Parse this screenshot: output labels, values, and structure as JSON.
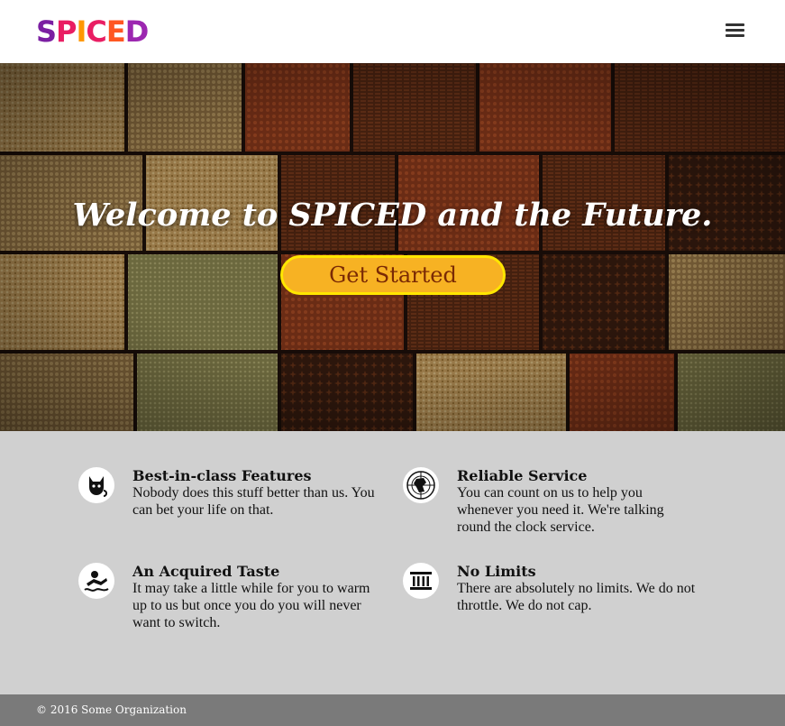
{
  "brand": {
    "letters": [
      {
        "char": "S",
        "color": "#7b1fa2"
      },
      {
        "char": "P",
        "color": "#e91e63"
      },
      {
        "char": "I",
        "color": "#ff9800"
      },
      {
        "char": "C",
        "color": "#e91e63"
      },
      {
        "char": "E",
        "color": "#ff5722"
      },
      {
        "char": "D",
        "color": "#9c27b0"
      }
    ]
  },
  "header": {
    "menu_icon": "hamburger-menu-icon"
  },
  "hero": {
    "title": "Welcome to SPICED and the Future.",
    "cta_label": "Get Started"
  },
  "features": [
    {
      "icon": "cat-icon",
      "title": "Best-in-class Features",
      "body": "Nobody does this stuff better than us. You can bet your life on that."
    },
    {
      "icon": "globe-icon",
      "title": "Reliable Service",
      "body": "You can count on us to help you whenever you need it. We're talking round the clock service."
    },
    {
      "icon": "swimmer-icon",
      "title": "An Acquired Taste",
      "body": "It may take a little while for you to warm up to us but once you do you will never want to switch."
    },
    {
      "icon": "bank-icon",
      "title": "No Limits",
      "body": "There are absolutely no limits. We do not throttle. We do not cap."
    }
  ],
  "footer": {
    "copyright": "© 2016 Some Organization"
  },
  "colors": {
    "accent": "#f7b223",
    "cta_border": "#ffe600",
    "cta_text": "#7a2a05",
    "features_bg": "#d0d0d0",
    "footer_bg": "#7a7a7a"
  }
}
